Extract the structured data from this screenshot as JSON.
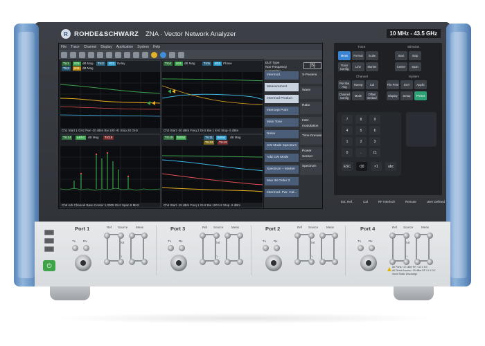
{
  "instrument": {
    "brand": "ROHDE&SCHWARZ",
    "model": "ZNA · Vector Network Analyzer",
    "freq_range": "10 MHz - 43.5 GHz"
  },
  "menu": [
    "File",
    "Trace",
    "Channel",
    "Display",
    "Application",
    "System",
    "Help"
  ],
  "toolbar_icons": [
    "undo-icon",
    "redo-icon",
    "zoom-icon",
    "trace-icon",
    "marker-icon",
    "marker-search-icon",
    "calibration-icon",
    "chart-icon",
    "grid-icon",
    "print-icon",
    "help-icon",
    "save-icon",
    "report-icon",
    "wrench-icon"
  ],
  "panes": [
    {
      "traces": [
        {
          "label": "Trc1",
          "meas": "S21",
          "format": "dB Mag",
          "color": "#3aa34b"
        },
        {
          "label": "Trc2",
          "meas": "S21",
          "format": "Delay",
          "color": "#3fb7e6"
        },
        {
          "label": "Trc3",
          "meas": "S11",
          "format": "dB Mag",
          "color": "#e9b021"
        }
      ],
      "footer": "Ch1 Start 1 GHz Pwr -20 dBm Bw 100 Hz Stop 20 GHz"
    },
    {
      "traces": [
        {
          "label": "Trc4",
          "meas": "S21",
          "format": "dB Mag",
          "color": "#3aa34b"
        },
        {
          "label": "Trc5",
          "meas": "S21",
          "format": "Phase",
          "color": "#3fb7e6"
        }
      ],
      "footer": "Ch2 Start -20 dBm Freq 2 GHz Bw 1 kHz Stop -5 dBm"
    },
    {
      "traces": [
        {
          "label": "Trc14",
          "meas": "a1/b1",
          "format": "dB Mag",
          "color": "#3aa34b"
        },
        {
          "label": "Trc15",
          "meas": "",
          "format": "dB Mag",
          "color": "#e05252"
        }
      ],
      "footer": "Ch6 Arb Channel Base Center 1.0005 GHz Span 8 MHz"
    },
    {
      "traces": [
        {
          "label": "Trc10",
          "meas": "b2/a1",
          "format": "dB Mag",
          "color": "#3aa34b"
        },
        {
          "label": "Trc11",
          "meas": "b2/a1",
          "format": "dB Mag",
          "color": "#3fb7e6"
        },
        {
          "label": "Trc12",
          "meas": "",
          "format": "",
          "color": "#e9b021"
        },
        {
          "label": "Trc13",
          "meas": "",
          "format": "",
          "color": "#e05252"
        }
      ],
      "footer": "Ch4 Start -15 dBm Freq 1 GHz Bw 100 Hz Stop -5 dBm"
    }
  ],
  "softkeys": {
    "header": "DUT Type\nNon-Frequency Converting",
    "s_button": "[S]",
    "left": [
      "Intermod.",
      "Measurement",
      "Intermod Product",
      "Intercept Point",
      "Main Tone",
      "Noise",
      "CW Mode Spectrum",
      "Add CW Mode",
      "Spectrum + Marker",
      "Max IM Order 3",
      "Intermod. Pwr. Cal..."
    ],
    "right": [
      "S-Params",
      "Wave",
      "Ratio",
      "Inter-modulation",
      "Time Domain",
      "Power Sensor",
      "Spectrum"
    ]
  },
  "keypad": {
    "trace_label": "Trace",
    "stimulus_label": "Stimulus",
    "channel_label": "Channel",
    "system_label": "System",
    "trace_keys": [
      "Meas",
      "Format",
      "Scale",
      "Trace Config",
      "Line",
      "Marker"
    ],
    "stimulus_keys": [
      "Start",
      "Stop",
      "Center",
      "Span"
    ],
    "channel_keys": [
      "Pwr Bw Avg",
      "Sweep",
      "Cal",
      "Channel Config",
      "Mode",
      "Offset Embed"
    ],
    "system_keys": [
      "File Print",
      "DUT",
      "Applic",
      "Display",
      "Setup",
      "Preset"
    ],
    "numbers": [
      "7",
      "8",
      "9",
      "4",
      "5",
      "6",
      "1",
      "2",
      "3",
      "0",
      ".",
      "±1"
    ],
    "extra_keys": [
      "ESC",
      "⌫",
      "×1",
      "abc"
    ],
    "bottom": [
      "Ext. Ref.",
      "Cal",
      "RF Interlock",
      "Remote",
      "User Defined"
    ]
  },
  "ports": [
    {
      "name": "Port 1",
      "ref": "Ref",
      "source": "Source",
      "meas": "Meas",
      "tx": "Tx",
      "rx": "Rx",
      "out": "Out",
      "in": "In"
    },
    {
      "name": "Port 3",
      "ref": "Ref",
      "source": "Source",
      "meas": "Meas",
      "tx": "Tx",
      "rx": "Rx",
      "out": "Out",
      "in": "In"
    },
    {
      "name": "Port 2",
      "ref": "Ref",
      "source": "Source",
      "meas": "Meas",
      "tx": "Tx",
      "rx": "Rx",
      "out": "Out",
      "in": "In"
    },
    {
      "name": "Port 4",
      "ref": "Ref",
      "source": "Source",
      "meas": "Meas",
      "tx": "Tx",
      "rx": "Rx",
      "out": "Out",
      "in": "In"
    }
  ],
  "warning": "All Ports +27 dBm RF / 30 V DC\nAll Direct Access +20 dBm RF / 0 V DC\nAvoid Static Discharge",
  "power_symbol": "⏻"
}
